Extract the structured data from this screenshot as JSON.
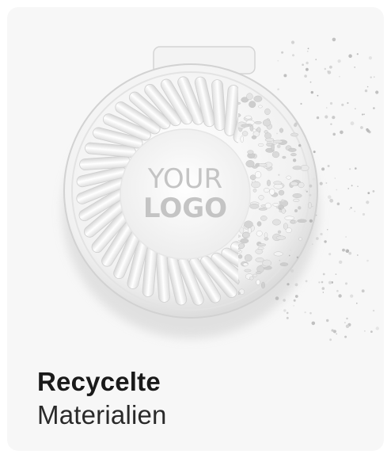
{
  "product": {
    "logo_line1": "YOUR",
    "logo_line2": "LOGO"
  },
  "caption": {
    "title_bold": "Recycelte",
    "title_light": "Materialien"
  },
  "colors": {
    "card_background": "#f7f7f7",
    "title_text": "#1a1a1a",
    "logo_text": "#c4c4c4"
  }
}
